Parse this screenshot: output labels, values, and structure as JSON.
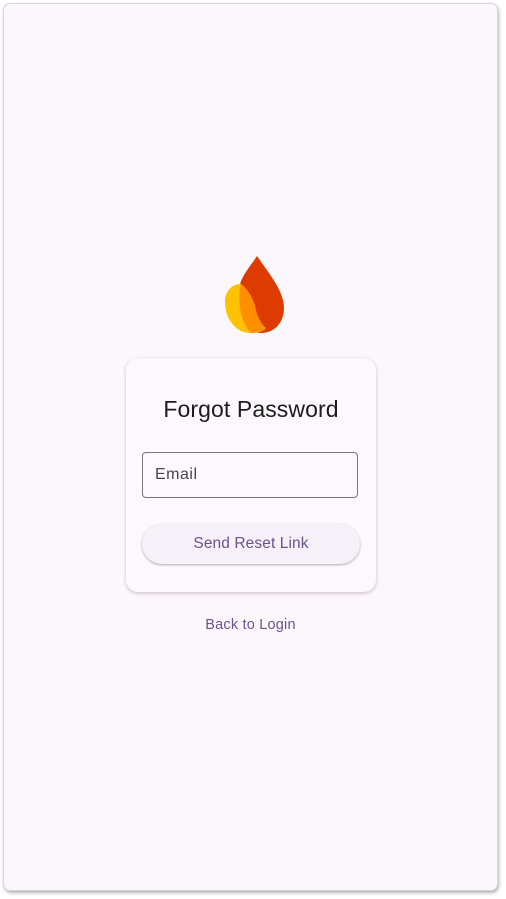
{
  "logo": {
    "icon": "flame-logo-icon",
    "colors": {
      "red": "#dd3b00",
      "orange": "#ff8f00",
      "yellow": "#ffc200"
    }
  },
  "card": {
    "title": "Forgot Password",
    "email": {
      "placeholder": "Email",
      "value": ""
    },
    "send_button_label": "Send Reset Link"
  },
  "back_link_label": "Back to Login",
  "colors": {
    "background": "#fcf7fc",
    "primary": "#65558f",
    "outline": "#79747e",
    "text": "#1d1b20"
  }
}
